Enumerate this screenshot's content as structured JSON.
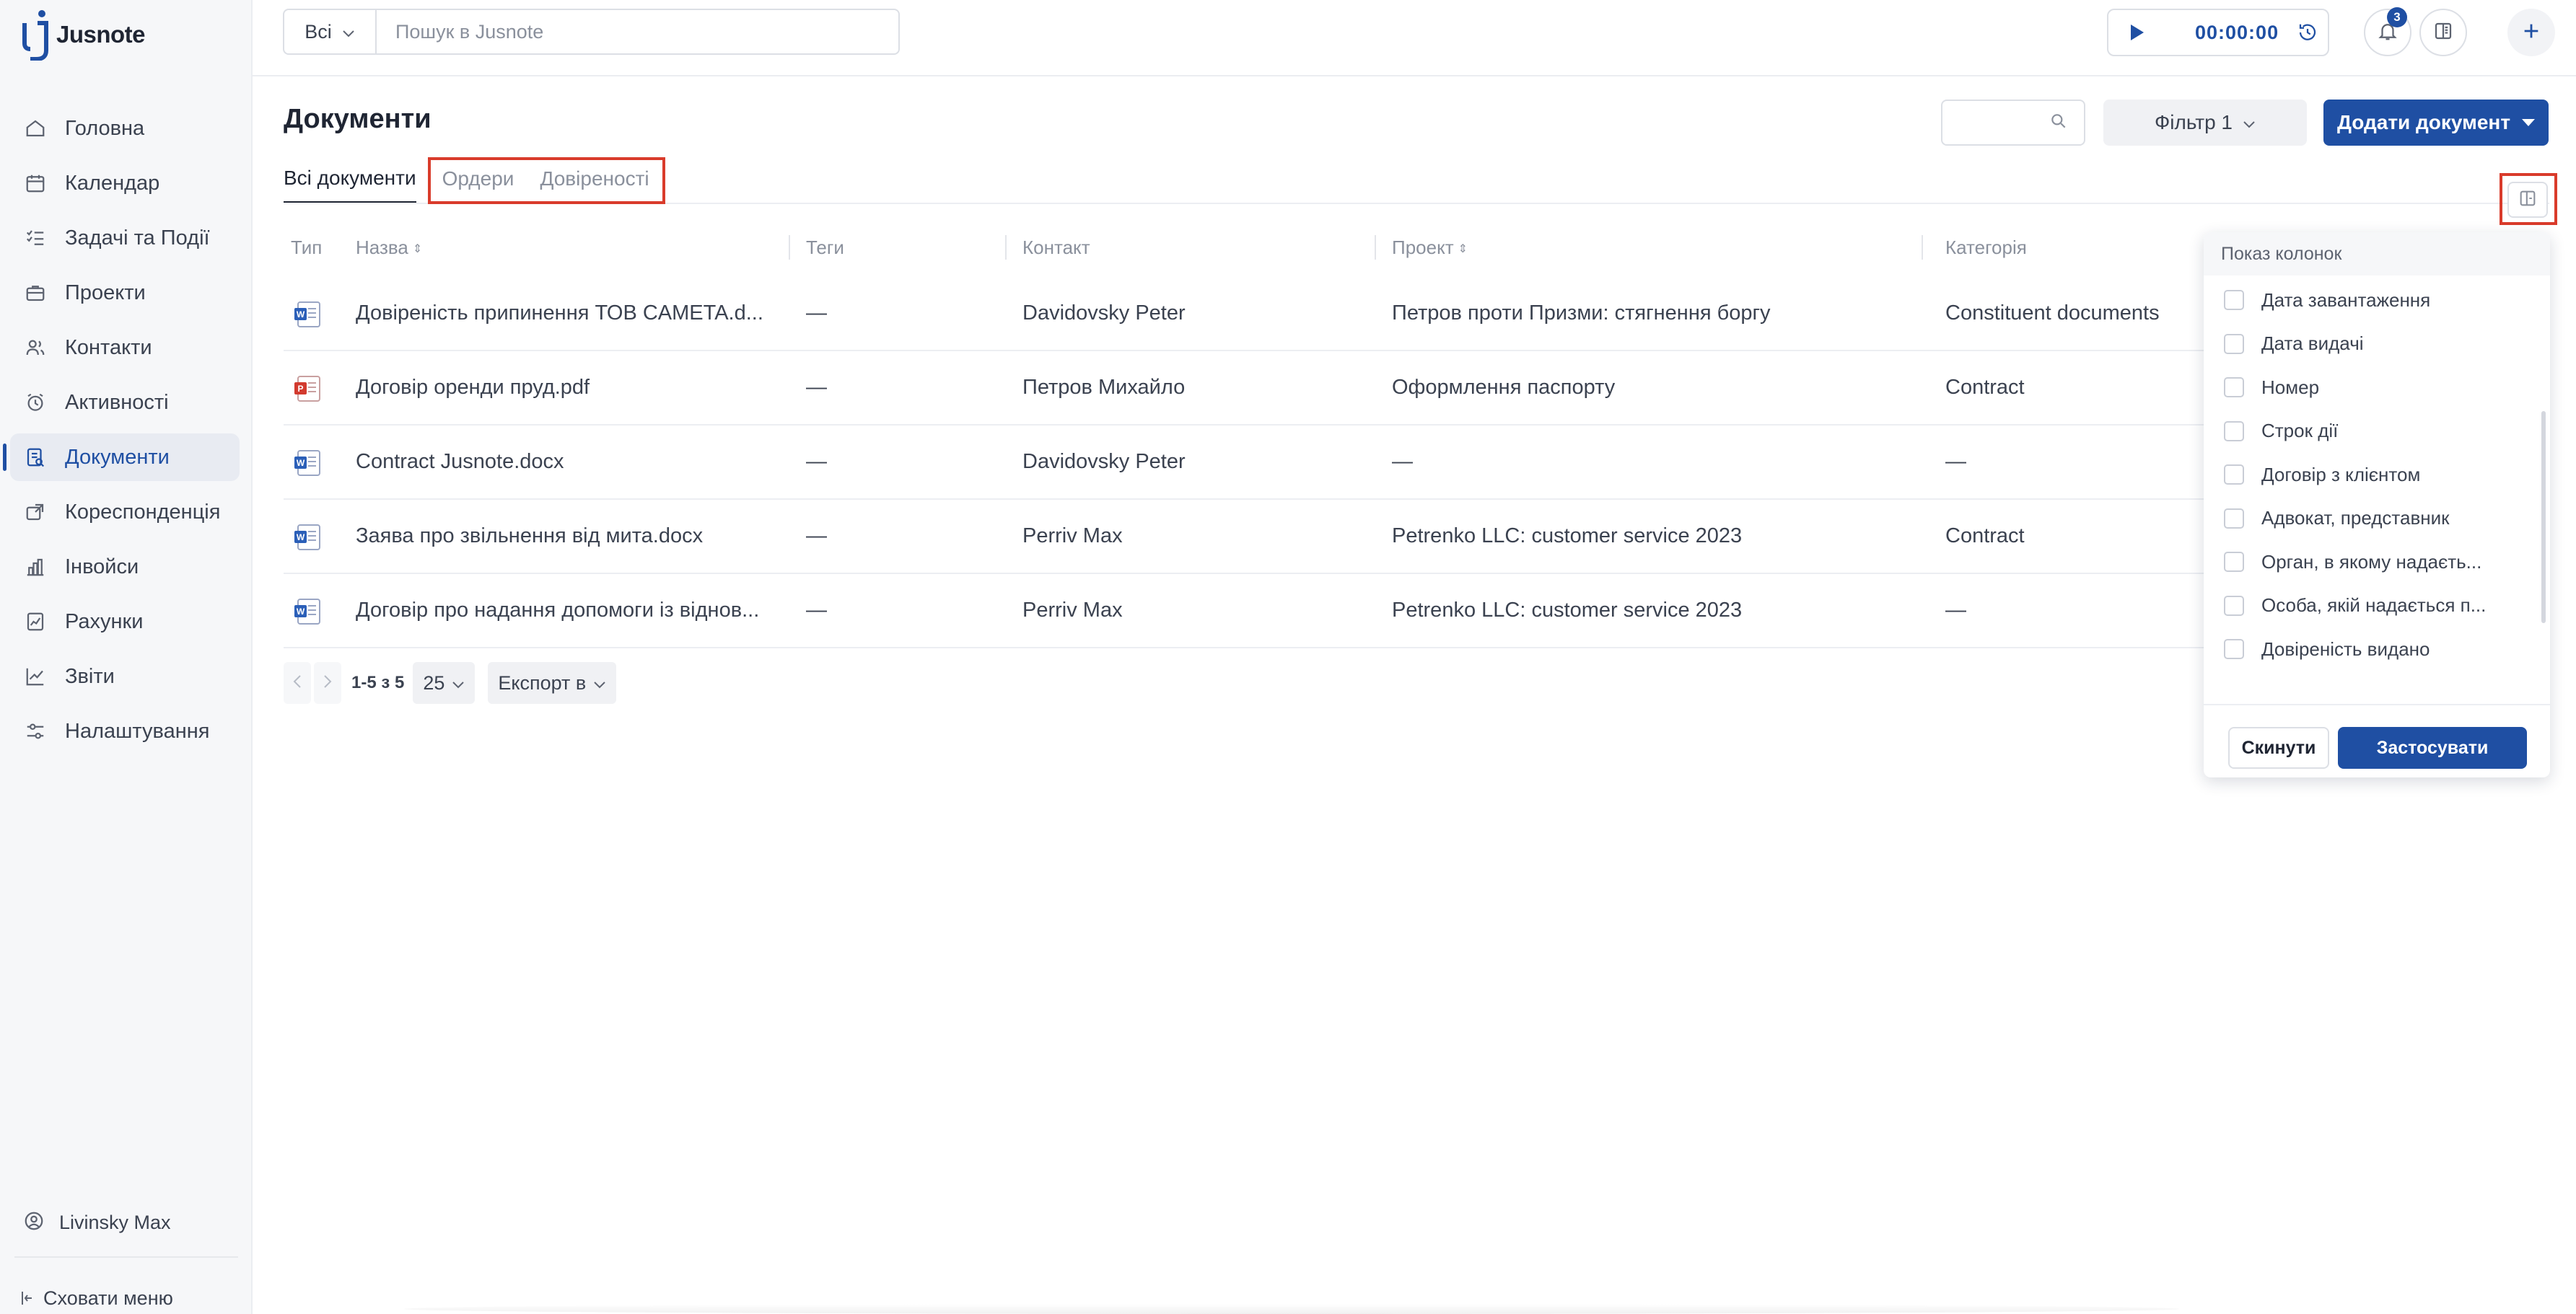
{
  "app": {
    "name": "Jusnote",
    "accent": "#1f4fa3"
  },
  "sidebar": {
    "items": [
      {
        "label": "Головна",
        "icon": "home-icon"
      },
      {
        "label": "Календар",
        "icon": "calendar-icon"
      },
      {
        "label": "Задачі та Події",
        "icon": "checklist-icon"
      },
      {
        "label": "Проекти",
        "icon": "briefcase-icon"
      },
      {
        "label": "Контакти",
        "icon": "contacts-icon"
      },
      {
        "label": "Активності",
        "icon": "alarm-clock-icon"
      },
      {
        "label": "Документи",
        "icon": "documents-icon",
        "active": true
      },
      {
        "label": "Кореспонденція",
        "icon": "mail-out-icon"
      },
      {
        "label": "Інвойси",
        "icon": "invoice-icon"
      },
      {
        "label": "Рахунки",
        "icon": "bills-icon"
      },
      {
        "label": "Звіти",
        "icon": "chart-icon"
      },
      {
        "label": "Налаштування",
        "icon": "sliders-icon"
      }
    ],
    "user": "Livinsky Max",
    "hide_menu": "Сховати меню"
  },
  "topbar": {
    "scope": "Всі",
    "search_placeholder": "Пошук в Jusnote",
    "timer": "00:00:00",
    "notifications_count": "3"
  },
  "page": {
    "title": "Документи",
    "filter_label": "Фільтр 1",
    "add_label": "Додати документ",
    "tabs": [
      "Всі документи",
      "Ордери",
      "Довіреності"
    ]
  },
  "table": {
    "headers": {
      "type": "Тип",
      "name": "Назва",
      "tags": "Теги",
      "contact": "Контакт",
      "project": "Проект",
      "category": "Категорія"
    },
    "rows": [
      {
        "type": "word",
        "name": "Довіреність припинення ТОВ CAMETA.d...",
        "tags": "—",
        "contact": "Davidovsky Peter",
        "project": "Петров проти Призми: стягнення боргу",
        "category": "Constituent documents"
      },
      {
        "type": "pdf",
        "name": "Договір оренди пруд.pdf",
        "tags": "—",
        "contact": "Петров Михайло",
        "project": "Оформлення паспорту",
        "category": "Contract"
      },
      {
        "type": "word",
        "name": "Contract Jusnote.docx",
        "tags": "—",
        "contact": "Davidovsky Peter",
        "project": "—",
        "category": "—"
      },
      {
        "type": "word",
        "name": "Заява про звільнення від мита.docx",
        "tags": "—",
        "contact": "Perriv Max",
        "project": "Petrenko LLC: customer service 2023",
        "category": "Contract"
      },
      {
        "type": "word",
        "name": "Договір про надання допомоги із віднов...",
        "tags": "—",
        "contact": "Perriv Max",
        "project": "Petrenko LLC: customer service 2023",
        "category": "—"
      }
    ]
  },
  "pager": {
    "info": "1-5 з 5",
    "page_size": "25",
    "export": "Експорт в"
  },
  "columns_panel": {
    "title": "Показ колонок",
    "options": [
      "Дата завантаження",
      "Дата видачі",
      "Номер",
      "Строк дії",
      "Договір з клієнтом",
      "Адвокат, представник",
      "Орган, в якому надаєть...",
      "Особа, якій надається п...",
      "Довіреність видано"
    ],
    "reset": "Скинути",
    "apply": "Застосувати"
  }
}
